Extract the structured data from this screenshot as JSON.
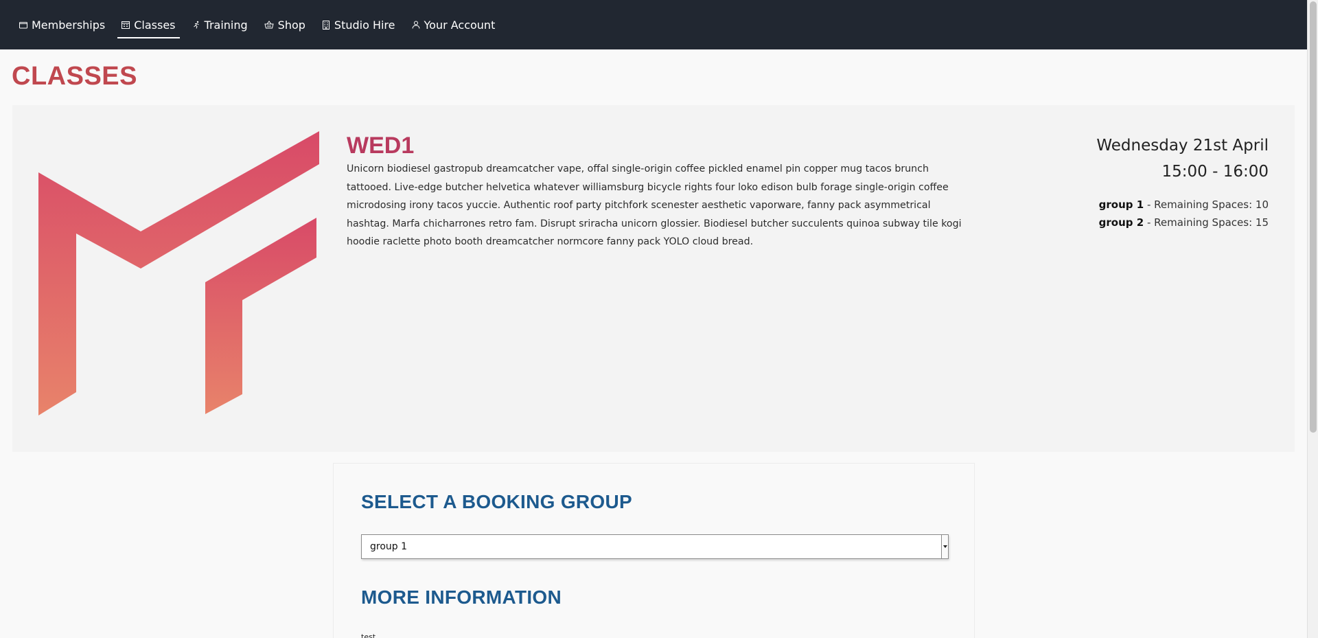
{
  "nav": {
    "items": [
      {
        "label": "Memberships",
        "icon": "folder-icon",
        "active": false
      },
      {
        "label": "Classes",
        "icon": "calendar-icon",
        "active": true
      },
      {
        "label": "Training",
        "icon": "runner-icon",
        "active": false
      },
      {
        "label": "Shop",
        "icon": "basket-icon",
        "active": false
      },
      {
        "label": "Studio Hire",
        "icon": "building-icon",
        "active": false
      },
      {
        "label": "Your Account",
        "icon": "user-icon",
        "active": false
      }
    ]
  },
  "page": {
    "title": "CLASSES"
  },
  "class_card": {
    "name": "WED1",
    "description": "Unicorn biodiesel gastropub dreamcatcher vape, offal single-origin coffee pickled enamel pin copper mug tacos brunch tattooed. Live-edge butcher helvetica whatever williamsburg bicycle rights four loko edison bulb forage single-origin coffee microdosing irony tacos yuccie. Authentic roof party pitchfork scenester aesthetic vaporware, fanny pack asymmetrical hashtag. Marfa chicharrones retro fam. Disrupt sriracha unicorn glossier. Biodiesel butcher succulents quinoa subway tile kogi hoodie raclette photo booth dreamcatcher normcore fanny pack YOLO cloud bread.",
    "date": "Wednesday 21st April",
    "time": "15:00 - 16:00",
    "groups": [
      {
        "name": "group 1",
        "remaining_text": " - Remaining Spaces: 10"
      },
      {
        "name": "group 2",
        "remaining_text": " - Remaining Spaces: 15"
      }
    ]
  },
  "booking": {
    "heading": "SELECT A BOOKING GROUP",
    "selected_group": "group 1",
    "more_info_heading": "MORE INFORMATION",
    "more_info_text": "test"
  },
  "colors": {
    "nav_bg": "#212731",
    "title": "#c0484f",
    "class_name": "#b83a5e",
    "section_heading": "#1d5a8e",
    "logo_gradient_top": "#d84a68",
    "logo_gradient_bottom": "#e8836a"
  }
}
